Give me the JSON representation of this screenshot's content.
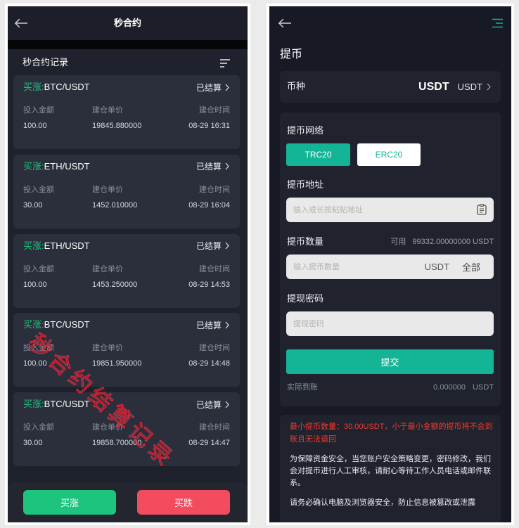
{
  "left": {
    "header": {
      "title": "秒合约"
    },
    "records": {
      "title": "秒合约记录",
      "labels": {
        "amount": "投入金额",
        "price": "建仓单价",
        "time": "建仓时间"
      },
      "items": [
        {
          "direction": "买涨:",
          "pair": "BTC/USDT",
          "status": "已结算",
          "amount": "100.00",
          "price": "19845.880000",
          "time": "08-29 16:31"
        },
        {
          "direction": "买涨:",
          "pair": "ETH/USDT",
          "status": "已结算",
          "amount": "30.00",
          "price": "1452.010000",
          "time": "08-29 16:04"
        },
        {
          "direction": "买涨:",
          "pair": "ETH/USDT",
          "status": "已结算",
          "amount": "100.00",
          "price": "1453.250000",
          "time": "08-29 14:53"
        },
        {
          "direction": "买涨:",
          "pair": "BTC/USDT",
          "status": "已结算",
          "amount": "100.00",
          "price": "19851.950000",
          "time": "08-29 14:48"
        },
        {
          "direction": "买涨:",
          "pair": "BTC/USDT",
          "status": "已结算",
          "amount": "30.00",
          "price": "19858.700000",
          "time": "08-29 14:47"
        }
      ]
    },
    "watermark": "秒合约结算记录",
    "actions": {
      "buy_up": "买涨",
      "buy_down": "买跌"
    }
  },
  "right": {
    "page_title": "提币",
    "currency": {
      "label": "币种",
      "value": "USDT",
      "selector": "USDT"
    },
    "network": {
      "label": "提币网络",
      "options": [
        "TRC20",
        "ERC20"
      ],
      "selected_index": 0
    },
    "address": {
      "label": "提币地址",
      "placeholder": "输入或长按粘贴地址"
    },
    "amount": {
      "label": "提币数量",
      "available_label": "可用",
      "available_value": "99332.00000000 USDT",
      "placeholder": "输入提币数量",
      "unit": "USDT",
      "all_label": "全部"
    },
    "password": {
      "label": "提现密码",
      "placeholder": "提现密码"
    },
    "submit_label": "提交",
    "received": {
      "label": "实际到账",
      "value": "0.000000",
      "unit": "USDT"
    },
    "notice": {
      "warning": "最小提币数量：30.00USDT，小于最小金额的提币将不会到账且无法退回",
      "paragraphs": [
        "为保障资金安全，当您账户安全策略变更，密码修改，我们会对提币进行人工审核，请耐心等待工作人员电话或邮件联系。",
        "请务必确认电脑及浏览器安全，防止信息被篡改或泄露"
      ]
    }
  },
  "icons": {
    "back": "arrow-left-icon",
    "filter": "filter-icon",
    "chevron": "chevron-right-icon",
    "menu": "menu-icon",
    "clipboard": "clipboard-icon"
  },
  "colors": {
    "green": "#1dc47e",
    "red": "#f24c5e",
    "teal": "#14b597",
    "warn": "#f3382f"
  }
}
